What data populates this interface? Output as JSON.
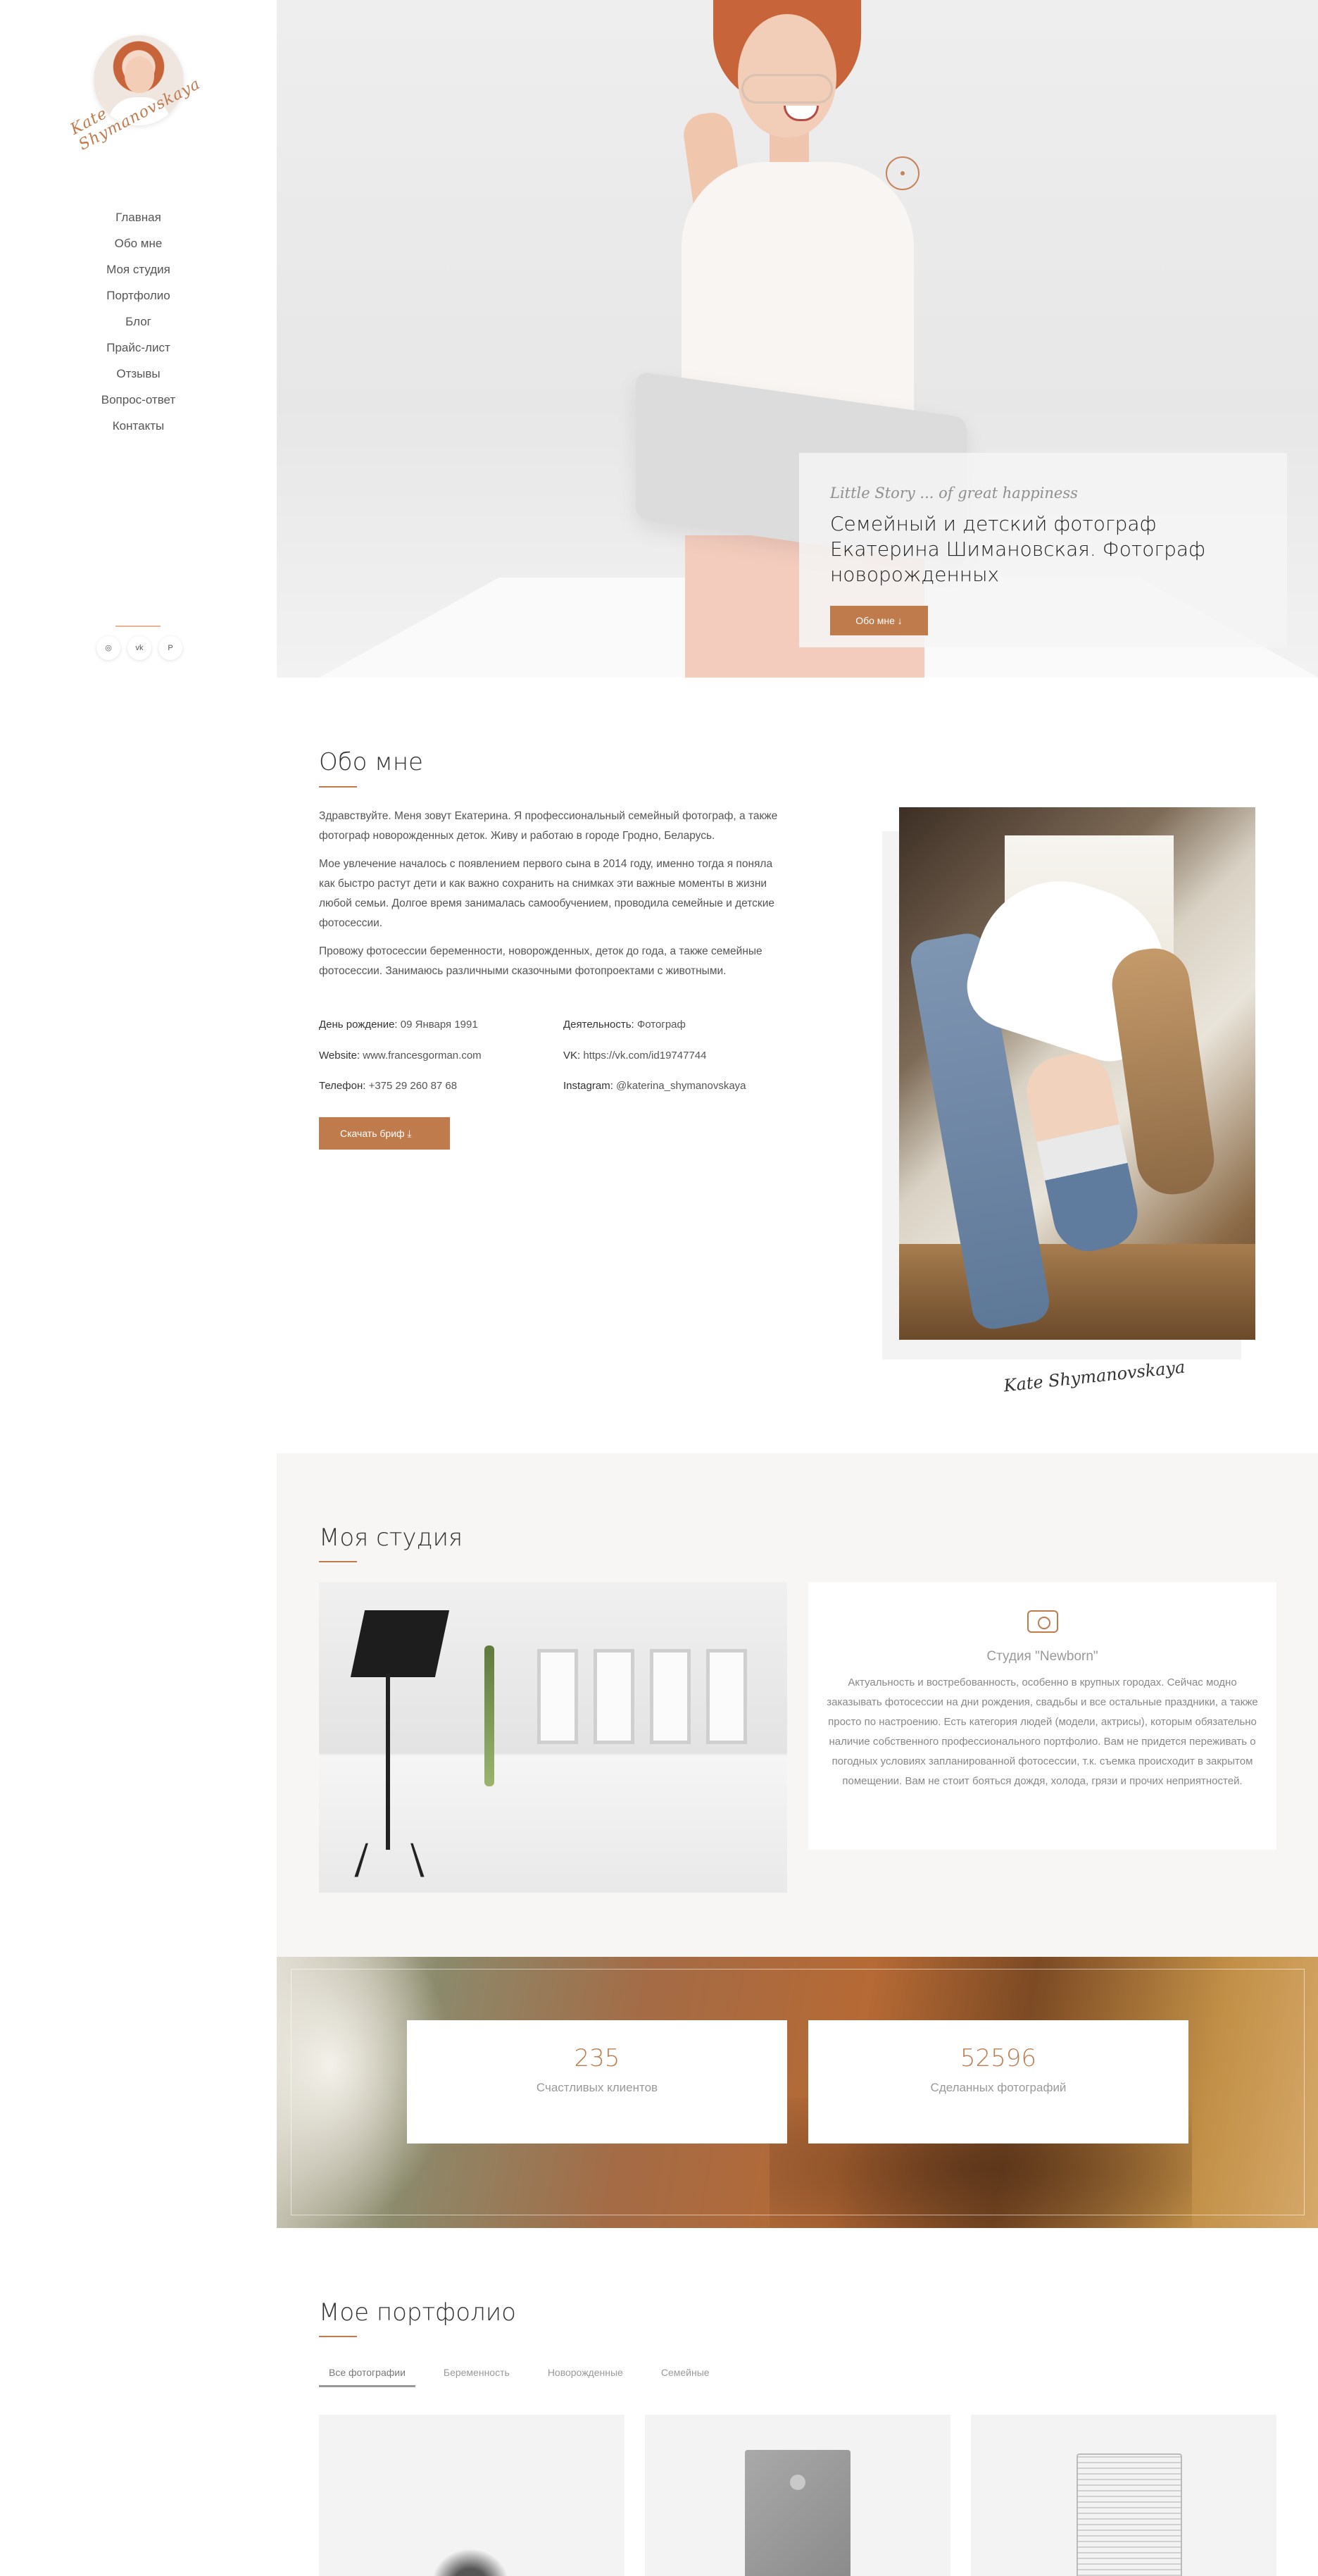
{
  "sidebar": {
    "signature": "Kate Shymanovskaya",
    "nav": [
      "Главная",
      "Обо мне",
      "Моя студия",
      "Портфолио",
      "Блог",
      "Прайс-лист",
      "Отзывы",
      "Вопрос-ответ",
      "Контакты"
    ],
    "socials": [
      "◎",
      "vk",
      "P"
    ]
  },
  "hero": {
    "script": "Little Story ... of great happiness",
    "title": "Семейный и детский фотограф Екатерина Шимановская. Фотограф новорожденных",
    "button": "Обо мне ↓"
  },
  "about": {
    "title": "Обо мне",
    "paragraphs": [
      "Здравствуйте. Меня зовут Екатерина. Я профессиональный семейный фотограф, а также фотограф новорожденных деток. Живу и работаю в городе Гродно, Беларусь.",
      "Мое увлечение началось с появлением первого сына в 2014 году, именно тогда я поняла как быстро растут дети и как важно сохранить на снимках эти важные моменты в жизни любой семьи. Долгое время занималась самообучением, проводила семейные и детские фотосессии.",
      "Провожу фотосессии беременности, новорожденных, деток до года, а также семейные фотосессии. Занимаюсь различными сказочными фотопроектами с животными."
    ],
    "info": {
      "birthday_label": "День рождение:",
      "birthday": "09 Января 1991",
      "activity_label": "Деятельность:",
      "activity": "Фотограф",
      "website_label": "Website:",
      "website": "www.francesgorman.com",
      "vk_label": "VK:",
      "vk": "https://vk.com/id19747744",
      "phone_label": "Телефон:",
      "phone": "+375 29 260 87 68",
      "instagram_label": "Instagram:",
      "instagram": "@katerina_shymanovskaya"
    },
    "download_button": "Скачать бриф ⤓",
    "signature": "Kate Shymanovskaya"
  },
  "studio": {
    "title": "Моя студия",
    "card_title": "Студия \"Newborn\"",
    "card_text": "Актуальность и востребованность, особенно в крупных городах. Сейчас модно заказывать фотосессии на дни рождения, свадьбы и все остальные праздники, а также просто по настроению. Есть категория людей (модели, актрисы), которым обязательно наличие собственного профессионального портфолио. Вам не придется переживать о погодных условиях запланированной фотосессии, т.к. съемка происходит в закрытом помещении. Вам не стоит бояться дождя, холода, грязи и прочих неприятностей."
  },
  "stats": [
    {
      "number": "235",
      "label": "Счастливых клиентов"
    },
    {
      "number": "52596",
      "label": "Сделанных фотографий"
    }
  ],
  "portfolio": {
    "title": "Мое портфолио",
    "tabs": [
      "Все фотографии",
      "Беременность",
      "Новорожденные",
      "Семейные"
    ]
  }
}
